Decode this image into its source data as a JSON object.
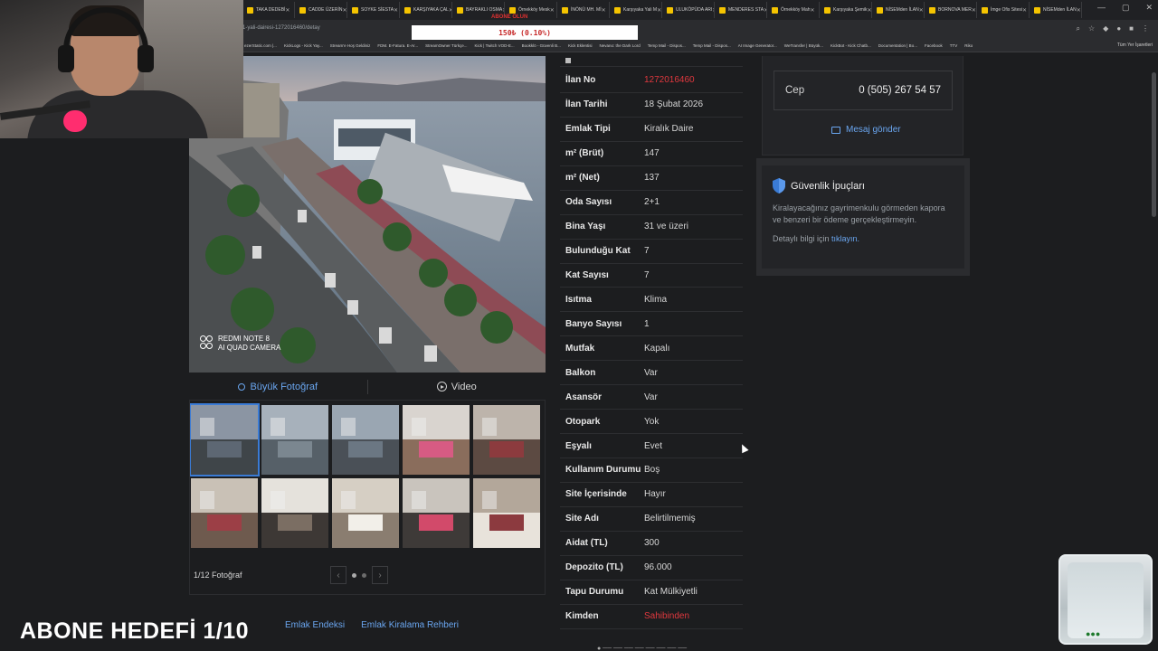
{
  "browser": {
    "tabs": [
      "TAKA DEDEBİ",
      "CADDE ÜZERİN",
      "SOYKE SİESTA",
      "KARŞIYAKA ÇAL",
      "BAYRAKLI OSMA",
      "Örnekköy Mesk",
      "İNÖNÜ MH. Mİ",
      "Karşıyaka Yali M",
      "ULUKÖPÜDA ARI",
      "MENDERES STA",
      "Örnekköy Mah",
      "Karşıyaka Şemik",
      "NİSEMden İLAN",
      "BORNOVA MER",
      "İmge Ofis Sitesi",
      "NİSEMden İLAN"
    ],
    "url": "1-yali-dairesi-1272016460/detay",
    "bookmarks": [
      "ezerStatic.com |...",
      "KickLogs - Kick Yay...",
      "Stream'e Hoş Geldiniz",
      "FDM. E-Fatura. E-Ar...",
      "StreamOwner Türkçe...",
      "Kick | Twitch VOD-E...",
      "Bookklö - Güvenli B...",
      "Kick Eklentisi",
      "Nevano: the Dark Lord",
      "Temp Mail - Dispos...",
      "Temp Mail - Dispos...",
      "AI Image Generator...",
      "WeTransfer | Büyük...",
      "KickBot - Kick Chatb...",
      "Documentation | Bo...",
      "Facebook",
      "TTV",
      "Riko"
    ],
    "all_bookmarks_label": "Tüm Yer İşaretleri",
    "overlay_alert": "150₺ (0.10%)",
    "overlay_label": "ABONE OLUN"
  },
  "media": {
    "camera_mark_line1": "REDMI NOTE 8",
    "camera_mark_line2": "AI QUAD CAMERA",
    "big_photo_label": "Büyük Fotoğraf",
    "video_label": "Video",
    "photo_count_label": "1/12 Fotoğraf",
    "prev_icon": "chevron-left-icon",
    "next_icon": "chevron-right-icon"
  },
  "details": [
    {
      "key": "İlan No",
      "value": "1272016460",
      "highlight": true
    },
    {
      "key": "İlan Tarihi",
      "value": "18 Şubat 2026"
    },
    {
      "key": "Emlak Tipi",
      "value": "Kiralık Daire"
    },
    {
      "key": "m² (Brüt)",
      "value": "147"
    },
    {
      "key": "m² (Net)",
      "value": "137"
    },
    {
      "key": "Oda Sayısı",
      "value": "2+1"
    },
    {
      "key": "Bina Yaşı",
      "value": "31 ve üzeri"
    },
    {
      "key": "Bulunduğu Kat",
      "value": "7"
    },
    {
      "key": "Kat Sayısı",
      "value": "7"
    },
    {
      "key": "Isıtma",
      "value": "Klima"
    },
    {
      "key": "Banyo Sayısı",
      "value": "1"
    },
    {
      "key": "Mutfak",
      "value": "Kapalı"
    },
    {
      "key": "Balkon",
      "value": "Var"
    },
    {
      "key": "Asansör",
      "value": "Var"
    },
    {
      "key": "Otopark",
      "value": "Yok"
    },
    {
      "key": "Eşyalı",
      "value": "Evet"
    },
    {
      "key": "Kullanım Durumu",
      "value": "Boş"
    },
    {
      "key": "Site İçerisinde",
      "value": "Hayır"
    },
    {
      "key": "Site Adı",
      "value": "Belirtilmemiş"
    },
    {
      "key": "Aidat (TL)",
      "value": "300"
    },
    {
      "key": "Depozito (TL)",
      "value": "96.000"
    },
    {
      "key": "Tapu Durumu",
      "value": "Kat Mülkiyetli"
    },
    {
      "key": "Kimden",
      "value": "Sahibinden",
      "highlight": true
    }
  ],
  "contact": {
    "phone_label": "Cep",
    "phone_number": "0 (505) 267 54 57",
    "message_link": "Mesaj gönder"
  },
  "safety": {
    "title": "Güvenlik İpuçları",
    "body": "Kiralayacağınız gayrimenkulu görmeden kapora ve benzeri bir ödeme gerçekleştirmeyin.",
    "more_prefix": "Detaylı bilgi için",
    "more_link": "tıklayın."
  },
  "footer_links": [
    "Emlak Endeksi",
    "Emlak Kiralama Rehberi"
  ],
  "stream_overlay": {
    "subscriber_goal": "ABONE HEDEFİ 1/10"
  },
  "colors": {
    "accent_blue": "#6aa6f0",
    "highlight_red": "#e0383e",
    "background": "#1c1d1f"
  }
}
